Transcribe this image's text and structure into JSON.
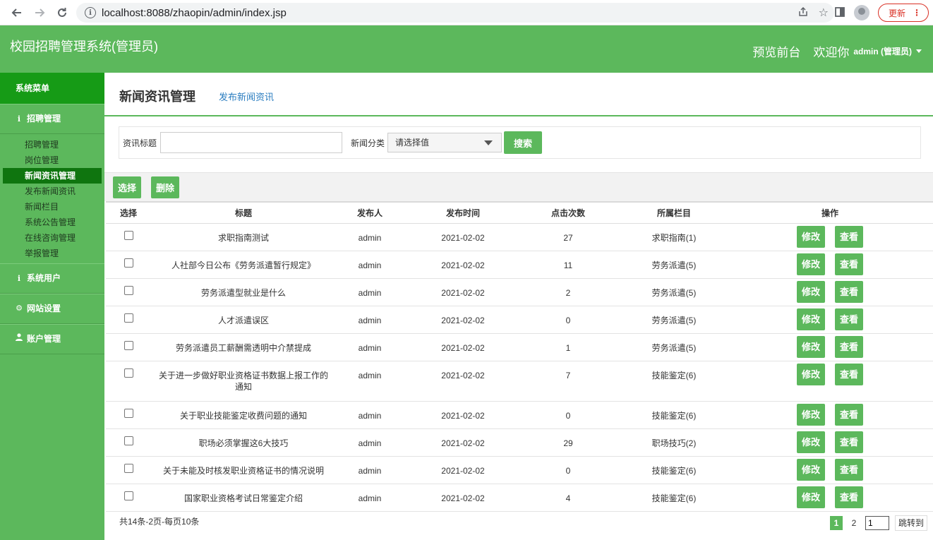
{
  "browser": {
    "url": "localhost:8088/zhaopin/admin/index.jsp",
    "update_label": "更新"
  },
  "header": {
    "app_title": "校园招聘管理系统(管理员)",
    "preview_label": "预览前台",
    "welcome_label": "欢迎你",
    "user_label": "admin (管理员)"
  },
  "sidebar": {
    "title": "系统菜单",
    "groups": [
      {
        "label": "招聘管理",
        "icon": "info-icon"
      },
      {
        "label": "系统用户",
        "icon": "info-icon"
      },
      {
        "label": "网站设置",
        "icon": "gear-icon"
      },
      {
        "label": "账户管理",
        "icon": "user-icon"
      }
    ],
    "items": [
      "招聘管理",
      "岗位管理",
      "新闻资讯管理",
      "发布新闻资讯",
      "新闻栏目",
      "系统公告管理",
      "在线咨询管理",
      "举报管理"
    ],
    "active_index": 2
  },
  "page": {
    "title": "新闻资讯管理",
    "publish_link": "发布新闻资讯"
  },
  "search": {
    "title_label": "资讯标题",
    "title_value": "",
    "category_label": "新闻分类",
    "category_value": "请选择值",
    "button": "搜索"
  },
  "toolbar": {
    "select_label": "选择",
    "delete_label": "删除"
  },
  "table": {
    "headers": [
      "选择",
      "标题",
      "发布人",
      "发布时间",
      "点击次数",
      "所属栏目",
      "操作"
    ],
    "edit_label": "修改",
    "view_label": "查看",
    "rows": [
      {
        "title": "求职指南测试",
        "publisher": "admin",
        "time": "2021-02-02",
        "clicks": "27",
        "column": "求职指南(1)"
      },
      {
        "title": "人社部今日公布《劳务派遣暂行规定》",
        "publisher": "admin",
        "time": "2021-02-02",
        "clicks": "11",
        "column": "劳务派遣(5)"
      },
      {
        "title": "劳务派遣型就业是什么",
        "publisher": "admin",
        "time": "2021-02-02",
        "clicks": "2",
        "column": "劳务派遣(5)"
      },
      {
        "title": "人才派遣误区",
        "publisher": "admin",
        "time": "2021-02-02",
        "clicks": "0",
        "column": "劳务派遣(5)"
      },
      {
        "title": "劳务派遣员工薪酬需透明中介禁提成",
        "publisher": "admin",
        "time": "2021-02-02",
        "clicks": "1",
        "column": "劳务派遣(5)"
      },
      {
        "title": "关于进一步做好职业资格证书数据上报工作的通知",
        "publisher": "admin",
        "time": "2021-02-02",
        "clicks": "7",
        "column": "技能鉴定(6)"
      },
      {
        "title": "关于职业技能鉴定收费问题的通知",
        "publisher": "admin",
        "time": "2021-02-02",
        "clicks": "0",
        "column": "技能鉴定(6)"
      },
      {
        "title": "职场必须掌握这6大技巧",
        "publisher": "admin",
        "time": "2021-02-02",
        "clicks": "29",
        "column": "职场技巧(2)"
      },
      {
        "title": "关于未能及时核发职业资格证书的情况说明",
        "publisher": "admin",
        "time": "2021-02-02",
        "clicks": "0",
        "column": "技能鉴定(6)"
      },
      {
        "title": "国家职业资格考试日常鉴定介绍",
        "publisher": "admin",
        "time": "2021-02-02",
        "clicks": "4",
        "column": "技能鉴定(6)"
      }
    ]
  },
  "pagination": {
    "summary": "共14条-2页-每页10条",
    "pages": [
      "1",
      "2"
    ],
    "current": "1",
    "jump_value": "1",
    "jump_label": "跳转到"
  },
  "colors": {
    "primary": "#5cb85c",
    "sidebar_head": "#169b16",
    "sidebar_active": "#0f750f",
    "link": "#2a7dc0"
  }
}
